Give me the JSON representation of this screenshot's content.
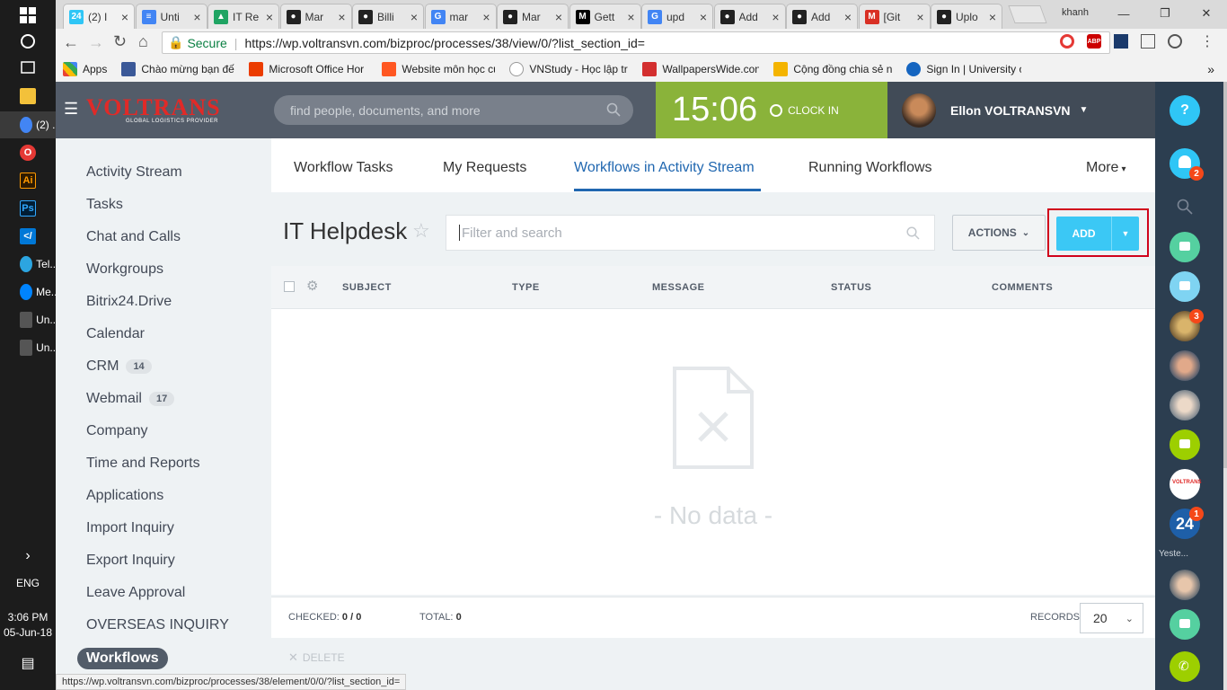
{
  "taskbar": {
    "apps": [
      {
        "label": "(2) ...",
        "color": "#4285f4"
      },
      {
        "label": "",
        "color": "#e53935"
      },
      {
        "label": "",
        "color": "#ff9a00"
      },
      {
        "label": "",
        "color": "#2b579a"
      },
      {
        "label": "",
        "color": "#0078d7"
      },
      {
        "label": "Tel...",
        "color": "#2ca5e0"
      },
      {
        "label": "Me...",
        "color": "#0084ff"
      },
      {
        "label": "Un...",
        "color": "#555"
      },
      {
        "label": "Un...",
        "color": "#555"
      }
    ],
    "lang": "ENG",
    "time": "3:06 PM",
    "date": "05-Jun-18"
  },
  "browser": {
    "profile": "khanh",
    "tabs": [
      {
        "label": "(2) I",
        "fav": "24",
        "color": "#2fc6f6"
      },
      {
        "label": "Unti",
        "fav": "≡",
        "color": "#4285f4"
      },
      {
        "label": "IT Re",
        "fav": "▲",
        "color": "#1fa463"
      },
      {
        "label": "Mar",
        "fav": "●",
        "color": "#222"
      },
      {
        "label": "Billi",
        "fav": "●",
        "color": "#222"
      },
      {
        "label": "mar",
        "fav": "G",
        "color": "#4285f4"
      },
      {
        "label": "Mar",
        "fav": "●",
        "color": "#222"
      },
      {
        "label": "Gett",
        "fav": "M",
        "color": "#000"
      },
      {
        "label": "upd",
        "fav": "G",
        "color": "#4285f4"
      },
      {
        "label": "Add",
        "fav": "●",
        "color": "#222"
      },
      {
        "label": "Add",
        "fav": "●",
        "color": "#222"
      },
      {
        "label": "[Git",
        "fav": "M",
        "color": "#d93025"
      },
      {
        "label": "Uplo",
        "fav": "●",
        "color": "#222"
      }
    ],
    "secure_label": "Secure",
    "url": "https://wp.voltransvn.com/bizproc/processes/38/view/0/?list_section_id=",
    "bookmarks": [
      {
        "label": "Apps",
        "color": "#5f6368"
      },
      {
        "label": "Chào mừng bạn đến",
        "color": "#3b5998"
      },
      {
        "label": "Microsoft Office Hor",
        "color": "#eb3c00"
      },
      {
        "label": "Website môn học củ",
        "color": "#ff5722"
      },
      {
        "label": "VNStudy - Học lập tr",
        "color": "#ffffff"
      },
      {
        "label": "VNStudy - Học lập tr",
        "color": "#d32f2f"
      },
      {
        "label": "WallpapersWide.con",
        "color": "#888"
      },
      {
        "label": "Cộng đồng chia sẻ n",
        "color": "#f4b400"
      },
      {
        "label": "Sign In | University o",
        "color": "#1565c0"
      }
    ],
    "status_url": "https://wp.voltransvn.com/bizproc/processes/38/element/0/0/?list_section_id="
  },
  "header": {
    "logo_main": "VOLTRANS",
    "logo_sub": "GLOBAL LOGISTICS PROVIDER",
    "search_placeholder": "find people, documents, and more",
    "clock_time": "15:06",
    "clock_action": "CLOCK IN",
    "user_name": "Ellon VOLTRANSVN"
  },
  "left_menu": {
    "items": [
      {
        "label": "Activity Stream",
        "count": ""
      },
      {
        "label": "Tasks",
        "count": ""
      },
      {
        "label": "Chat and Calls",
        "count": ""
      },
      {
        "label": "Workgroups",
        "count": ""
      },
      {
        "label": "Bitrix24.Drive",
        "count": ""
      },
      {
        "label": "Calendar",
        "count": ""
      },
      {
        "label": "CRM",
        "count": "14"
      },
      {
        "label": "Webmail",
        "count": "17"
      },
      {
        "label": "Company",
        "count": ""
      },
      {
        "label": "Time and Reports",
        "count": ""
      },
      {
        "label": "Applications",
        "count": ""
      },
      {
        "label": "Import Inquiry",
        "count": ""
      },
      {
        "label": "Export Inquiry",
        "count": ""
      },
      {
        "label": "Leave Approval",
        "count": ""
      },
      {
        "label": "OVERSEAS INQUIRY",
        "count": ""
      }
    ],
    "active": "Workflows"
  },
  "nav": {
    "tabs": [
      "Workflow Tasks",
      "My Requests",
      "Workflows in Activity Stream",
      "Running Workflows"
    ],
    "more": "More"
  },
  "toolbar": {
    "title": "IT Helpdesk",
    "filter_placeholder": "Filter and search",
    "actions_label": "ACTIONS",
    "add_label": "ADD"
  },
  "table": {
    "columns": [
      "SUBJECT",
      "TYPE",
      "MESSAGE",
      "STATUS",
      "COMMENTS"
    ],
    "empty_text": "- No data -"
  },
  "footer": {
    "checked_label": "CHECKED:",
    "checked_value": "0 / 0",
    "total_label": "TOTAL:",
    "total_value": "0",
    "records_label": "RECORDS:",
    "records_value": "20",
    "delete_label": "DELETE"
  },
  "right_bar": {
    "help": "?",
    "notifications": "2",
    "badge_count": "3",
    "b24_label": "24",
    "b24_badge": "1",
    "yesterday": "Yeste..."
  },
  "colors": {
    "header_bg": "#535c69",
    "clock_bg": "#8ab33a",
    "add_button": "#3bc8f5",
    "active_tab": "#2067b0",
    "highlight": "#d0021b"
  }
}
